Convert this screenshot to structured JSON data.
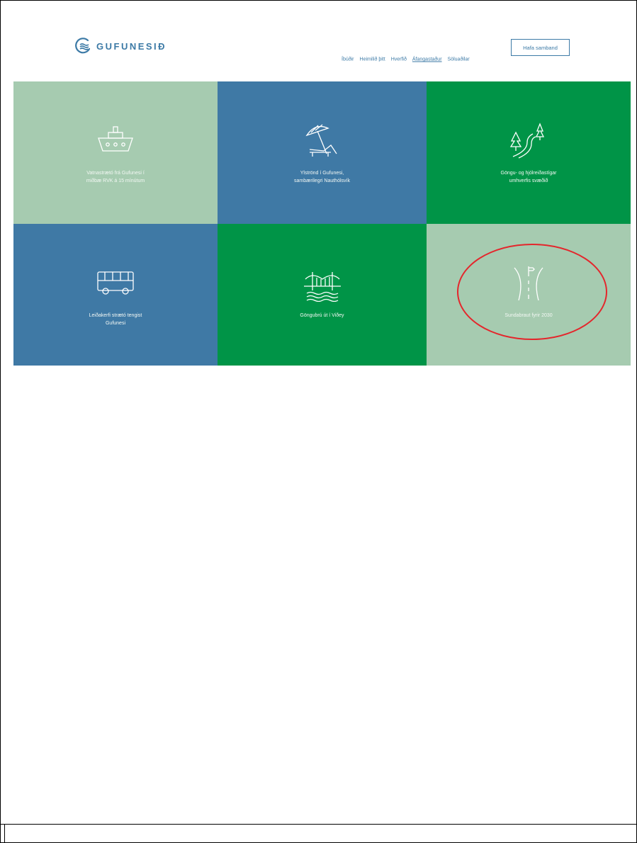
{
  "header": {
    "logo_text": "GUFUNESIÐ",
    "nav": [
      "Íbúðir",
      "Heimilið þitt",
      "Hverfið",
      "Áfangastaður",
      "Söluaðilar"
    ],
    "active_nav": "Áfangastaður",
    "contact_label": "Hafa samband"
  },
  "tiles": [
    {
      "caption1": "Vatnastrætó frá Gufunesi í",
      "caption2": "miðbæ RVK á 15 mínútum",
      "icon": "ferry-icon",
      "color": "#a6cbb0"
    },
    {
      "caption1": "Ylströnd í Gufunesi,",
      "caption2": "sambærilegri Nauthólsvík",
      "icon": "beach-umbrella-icon",
      "color": "#3f79a5"
    },
    {
      "caption1": "Göngu- og hjólreiðastígar",
      "caption2": "umhverfis svæðið",
      "icon": "trail-trees-icon",
      "color": "#009447"
    },
    {
      "caption1": "Leiðakerfi strætó tengist",
      "caption2": "Gufunesi",
      "icon": "bus-icon",
      "color": "#3f79a5"
    },
    {
      "caption1": "Göngubrú út í Viðey",
      "caption2": "",
      "icon": "bridge-icon",
      "color": "#009447"
    },
    {
      "caption1": "Sundabraut fyrir 2030",
      "caption2": "",
      "icon": "road-icon",
      "color": "#a6cbb0"
    }
  ],
  "annotation": {
    "color": "#e4262c"
  }
}
